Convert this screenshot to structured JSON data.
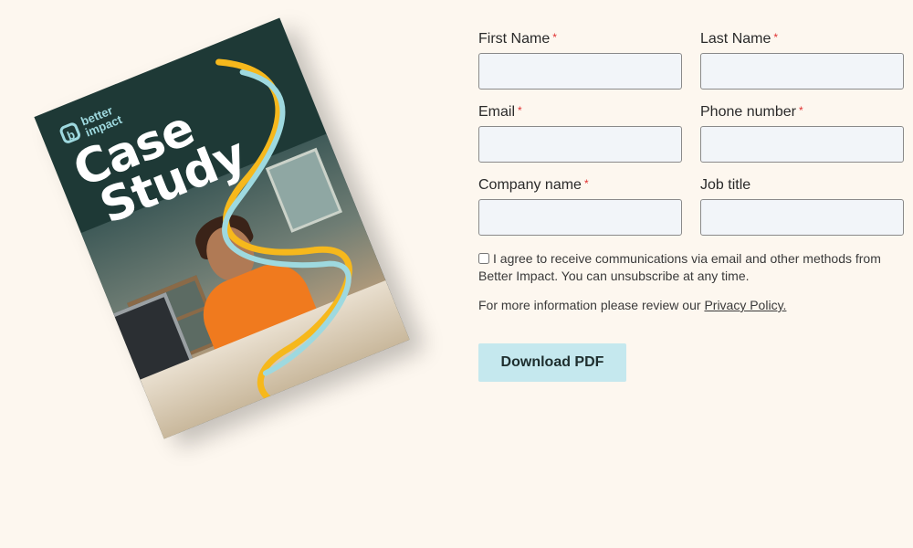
{
  "cover": {
    "brand_line1": "better",
    "brand_line2": "impact",
    "brand_mark": "b",
    "title_line1": "Case",
    "title_line2": "Study",
    "colors": {
      "background": "#1e3936",
      "accent_blue": "#9ed9df",
      "accent_yellow": "#f6b81c",
      "shirt": "#f07a1e"
    }
  },
  "form": {
    "first_name": {
      "label": "First Name",
      "required_mark": "*",
      "value": ""
    },
    "last_name": {
      "label": "Last Name",
      "required_mark": "*",
      "value": ""
    },
    "email": {
      "label": "Email",
      "required_mark": "*",
      "value": ""
    },
    "phone": {
      "label": "Phone number",
      "required_mark": "*",
      "value": ""
    },
    "company": {
      "label": "Company name",
      "required_mark": "*",
      "value": ""
    },
    "job_title": {
      "label": "Job title",
      "value": ""
    },
    "consent_text": "I agree to receive communications via email and other methods from Better Impact. You can unsubscribe at any time.",
    "info_text": "For more information please review our ",
    "privacy_link": "Privacy Policy.",
    "submit_label": "Download PDF"
  },
  "theme": {
    "page_background": "#fdf7ef",
    "input_background": "#f2f5f9",
    "button_background": "#c5e8ee",
    "required_color": "#e03030"
  }
}
